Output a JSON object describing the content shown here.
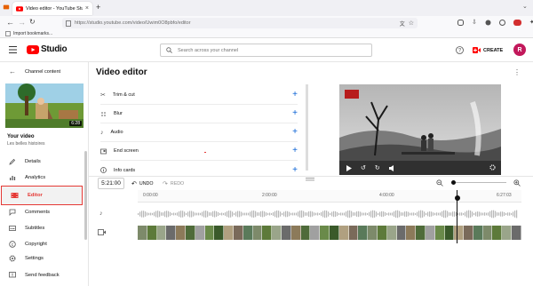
{
  "browser": {
    "tab_title": "Video editor - YouTube Studio",
    "url": "https://studio.youtube.com/video/Uwim0O8pbfo/editor",
    "bookmarks_label": "Import bookmarks..."
  },
  "header": {
    "logo_text": "Studio",
    "search_placeholder": "Search across your channel",
    "create_label": "CREATE",
    "avatar_letter": "R"
  },
  "sidebar": {
    "back_label": "Channel content",
    "thumb_duration": "6:28",
    "your_video_label": "Your video",
    "video_title": "Les belles histoires",
    "items": [
      {
        "label": "Details",
        "icon": "pencil-icon"
      },
      {
        "label": "Analytics",
        "icon": "analytics-icon"
      },
      {
        "label": "Editor",
        "icon": "film-icon",
        "active": true
      },
      {
        "label": "Comments",
        "icon": "comment-icon"
      },
      {
        "label": "Subtitles",
        "icon": "subtitles-icon"
      },
      {
        "label": "Copyright",
        "icon": "copyright-icon"
      }
    ],
    "bottom_items": [
      {
        "label": "Settings",
        "icon": "gear-icon"
      },
      {
        "label": "Send feedback",
        "icon": "feedback-icon"
      }
    ]
  },
  "editor": {
    "title": "Video editor",
    "tools": [
      {
        "label": "Trim & cut",
        "icon": "scissors-icon"
      },
      {
        "label": "Blur",
        "icon": "blur-icon"
      },
      {
        "label": "Audio",
        "icon": "music-icon"
      },
      {
        "label": "End screen",
        "icon": "end-screen-icon"
      },
      {
        "label": "Info cards",
        "icon": "info-icon"
      }
    ]
  },
  "timeline": {
    "timecode": "5:21:00",
    "undo_label": "UNDO",
    "redo_label": "REDO",
    "ticks": [
      "0:00:00",
      "2:00:00",
      "4:00:00",
      "6:27:03"
    ]
  },
  "colors": {
    "accent": "#065fd4",
    "youtube_red": "#ff0000",
    "active_border": "#e53935"
  }
}
